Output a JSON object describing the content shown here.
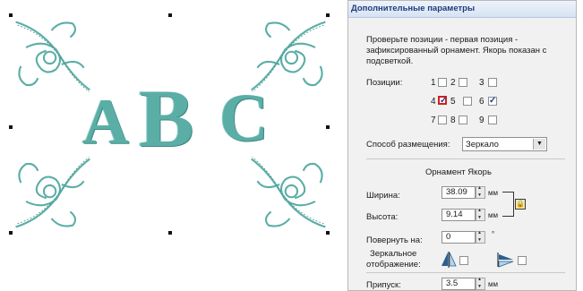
{
  "canvas": {
    "letters": [
      "A",
      "B",
      "C"
    ],
    "accent_color": "#5aaea6"
  },
  "panel": {
    "title": "Дополнительные параметры",
    "description": "Проверьте позиции - первая позиция - зафиксированный орнамент. Якорь показан с подсветкой.",
    "positions_label": "Позиции:",
    "positions": [
      {
        "num": "1",
        "checked": false
      },
      {
        "num": "2",
        "checked": false
      },
      {
        "num": "3",
        "checked": false
      },
      {
        "num": "4",
        "checked": true,
        "anchor": true
      },
      {
        "num": "5",
        "checked": false
      },
      {
        "num": "6",
        "checked": true
      },
      {
        "num": "7",
        "checked": false
      },
      {
        "num": "8",
        "checked": false
      },
      {
        "num": "9",
        "checked": false
      }
    ],
    "placement_label": "Способ размещения:",
    "placement_value": "Зеркало",
    "section_title": "Орнамент Якорь",
    "width_label": "Ширина:",
    "width_value": "38.09",
    "height_label": "Высота:",
    "height_value": "9.14",
    "unit": "мм",
    "rotate_label": "Повернуть на:",
    "rotate_value": "0",
    "rotate_unit": "°",
    "mirror_label_1": "Зеркальное",
    "mirror_label_2": "отображение:",
    "gap_label": "Припуск:",
    "gap_value": "3.5"
  }
}
